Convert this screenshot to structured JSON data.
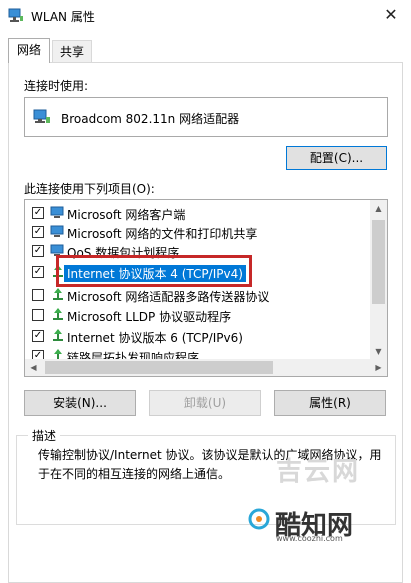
{
  "window": {
    "title": "WLAN 属性",
    "close_glyph": "✕"
  },
  "tabs": [
    {
      "label": "网络",
      "active": true
    },
    {
      "label": "共享",
      "active": false
    }
  ],
  "connect_using": {
    "label": "连接时使用:",
    "adapter_name": "Broadcom 802.11n 网络适配器",
    "adapter_icon": "network-adapter-icon",
    "configure_button": "配置(C)..."
  },
  "items_section": {
    "label": "此连接使用下列项目(O):",
    "items": [
      {
        "label": "Microsoft 网络客户端",
        "checked": true,
        "icon": "network-client-icon"
      },
      {
        "label": "Microsoft 网络的文件和打印机共享",
        "checked": true,
        "icon": "network-client-icon"
      },
      {
        "label": "QoS 数据包计划程序",
        "checked": true,
        "icon": "network-client-icon"
      },
      {
        "label": "Internet 协议版本 4 (TCP/IPv4)",
        "checked": true,
        "selected": true,
        "icon": "protocol-icon"
      },
      {
        "label": "Microsoft 网络适配器多路传送器协议",
        "checked": false,
        "icon": "protocol-icon"
      },
      {
        "label": "Microsoft LLDP 协议驱动程序",
        "checked": false,
        "icon": "protocol-icon"
      },
      {
        "label": "Internet 协议版本 6 (TCP/IPv6)",
        "checked": true,
        "icon": "protocol-icon"
      },
      {
        "label": "链路层拓扑发现响应程序",
        "checked": true,
        "icon": "protocol-icon"
      }
    ],
    "scroll_up": "▲",
    "scroll_down": "▼",
    "scroll_left": "◀",
    "scroll_right": "▶"
  },
  "actions": {
    "install": "安装(N)...",
    "uninstall": "卸载(U)",
    "properties": "属性(R)"
  },
  "description": {
    "title": "描述",
    "text": "传输控制协议/Internet 协议。该协议是默认的广域网络协议，用于在不同的相互连接的网络上通信。"
  },
  "watermark": {
    "jiyun": "吉云网",
    "brand": "酷知网",
    "url": "www.coozhi.com"
  },
  "colors": {
    "selection": "#0078d7",
    "highlight_box": "#c62828"
  }
}
